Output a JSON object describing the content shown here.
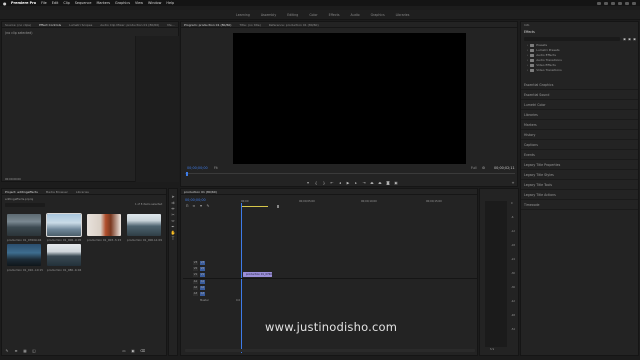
{
  "menubar": {
    "apple": "",
    "items": [
      "Premiere Pro",
      "File",
      "Edit",
      "Clip",
      "Sequence",
      "Markers",
      "Graphics",
      "View",
      "Window",
      "Help"
    ]
  },
  "workspaces": [
    "Learning",
    "Assembly",
    "Editing",
    "Color",
    "Effects",
    "Audio",
    "Graphics",
    "Libraries"
  ],
  "source_panel": {
    "tabs": [
      "Source: (no clips)",
      "Effect Controls",
      "Lumetri Scopes",
      "Audio Clip Mixer: production 01 (80/60)",
      "Me..."
    ],
    "no_clip_text": "(no clip selected)",
    "timecode": "00:00:00:00"
  },
  "program_panel": {
    "tabs": [
      "Program: production 01 (80/60)",
      "Title: (no title)",
      "Reference: production 01 (80/60)"
    ],
    "timecode_left": "00;00;00;00",
    "zoom": "Fit",
    "quality": "Full",
    "timecode_right": "00;00;02;11"
  },
  "project_panel": {
    "tabs": [
      "Project: editingeffects",
      "Media Browser",
      "Libraries"
    ],
    "project_file": "editingeffects.prproj",
    "item_count": "1 of 8 items selected",
    "clips": [
      {
        "name": "production 01_0760...",
        "duration": "0:04"
      },
      {
        "name": "production 01_006...",
        "duration": "9:05"
      },
      {
        "name": "production 01_003...",
        "duration": "5:15"
      },
      {
        "name": "production 01_000...",
        "duration": "11:09"
      },
      {
        "name": "production 01_010...",
        "duration": "10:15"
      },
      {
        "name": "production 01_080...",
        "duration": "6:04"
      }
    ]
  },
  "timeline": {
    "tab": "production 01 (80/60)",
    "timecode": "00;00;00;00",
    "ruler": [
      "00;00",
      "00;00;05;00",
      "00;00;10;00",
      "00;00;15;00",
      "00;00;20;00"
    ],
    "clip_label": "production 01_0760",
    "video_tracks": [
      "V3",
      "V2",
      "V1"
    ],
    "audio_tracks": [
      "A1",
      "A2",
      "A3"
    ],
    "master": "Master",
    "master_value": "0.0"
  },
  "effects_panel": {
    "tab_info": "Info",
    "title": "Effects",
    "tree": [
      "Presets",
      "Lumetri Presets",
      "Audio Effects",
      "Audio Transitions",
      "Video Effects",
      "Video Transitions"
    ],
    "sections": [
      "Essential Graphics",
      "Essential Sound",
      "Lumetri Color",
      "Libraries",
      "Markers",
      "History",
      "Captions",
      "Events",
      "Legacy Title Properties",
      "Legacy Title Styles",
      "Legacy Title Tools",
      "Legacy Title Actions",
      "Timecode"
    ]
  },
  "audio_meter": {
    "scale": [
      "0",
      "-6",
      "-12",
      "-18",
      "-24",
      "-30",
      "-36",
      "-42",
      "-48",
      "-54"
    ],
    "footer": "S S"
  },
  "watermark": "www.justinodisho.com",
  "colors": {
    "accent_blue": "#3d7be8",
    "clip_purple": "#9b8fd8",
    "track_blue": "#3a5c9c",
    "yellow_bar": "#d6c64a"
  }
}
